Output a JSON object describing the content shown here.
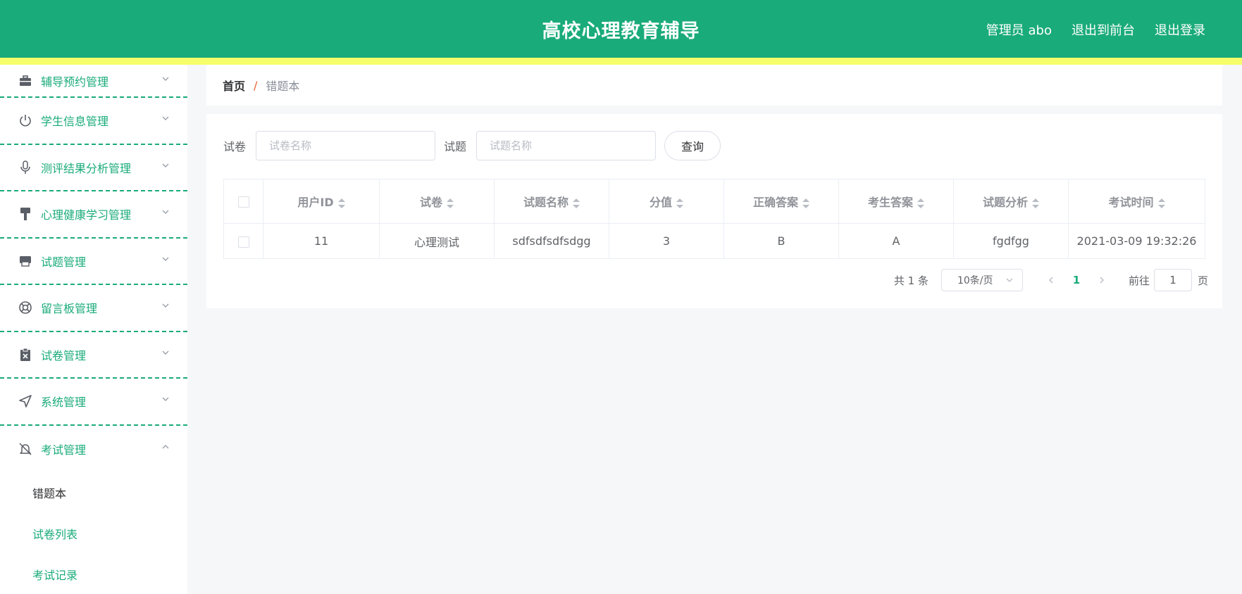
{
  "header": {
    "title": "高校心理教育辅导",
    "admin_label": "管理员 abo",
    "front_link": "退出到前台",
    "logout_link": "退出登录"
  },
  "sidebar": {
    "items": [
      {
        "label": "辅导预约管理",
        "icon": "briefcase-icon"
      },
      {
        "label": "学生信息管理",
        "icon": "power-icon"
      },
      {
        "label": "测评结果分析管理",
        "icon": "microphone-icon"
      },
      {
        "label": "心理健康学习管理",
        "icon": "brush-icon"
      },
      {
        "label": "试题管理",
        "icon": "printer-icon"
      },
      {
        "label": "留言板管理",
        "icon": "lifebuoy-icon"
      },
      {
        "label": "试卷管理",
        "icon": "clipboard-x-icon"
      },
      {
        "label": "系统管理",
        "icon": "send-icon"
      },
      {
        "label": "考试管理",
        "icon": "bell-off-icon"
      }
    ],
    "submenu": [
      {
        "label": "错题本",
        "active": true
      },
      {
        "label": "试卷列表",
        "active": false
      },
      {
        "label": "考试记录",
        "active": false
      }
    ]
  },
  "breadcrumb": {
    "home": "首页",
    "separator": "/",
    "current": "错题本"
  },
  "search": {
    "paper_label": "试卷",
    "paper_placeholder": "试卷名称",
    "question_label": "试题",
    "question_placeholder": "试题名称",
    "query_button": "查询"
  },
  "table": {
    "columns": [
      "用户ID",
      "试卷",
      "试题名称",
      "分值",
      "正确答案",
      "考生答案",
      "试题分析",
      "考试时间"
    ],
    "rows": [
      [
        "11",
        "心理测试",
        "sdfsdfsdfsdgg",
        "3",
        "B",
        "A",
        "fgdfgg",
        "2021-03-09 19:32:26"
      ]
    ]
  },
  "pagination": {
    "total": "共 1 条",
    "page_size": "10条/页",
    "current_page": "1",
    "jump_label": "前往",
    "jump_value": "1",
    "jump_unit": "页"
  },
  "colors": {
    "primary": "#1aab7a",
    "accent_bar": "#f6ff6a",
    "breadcrumb_separator": "#e6622f"
  }
}
